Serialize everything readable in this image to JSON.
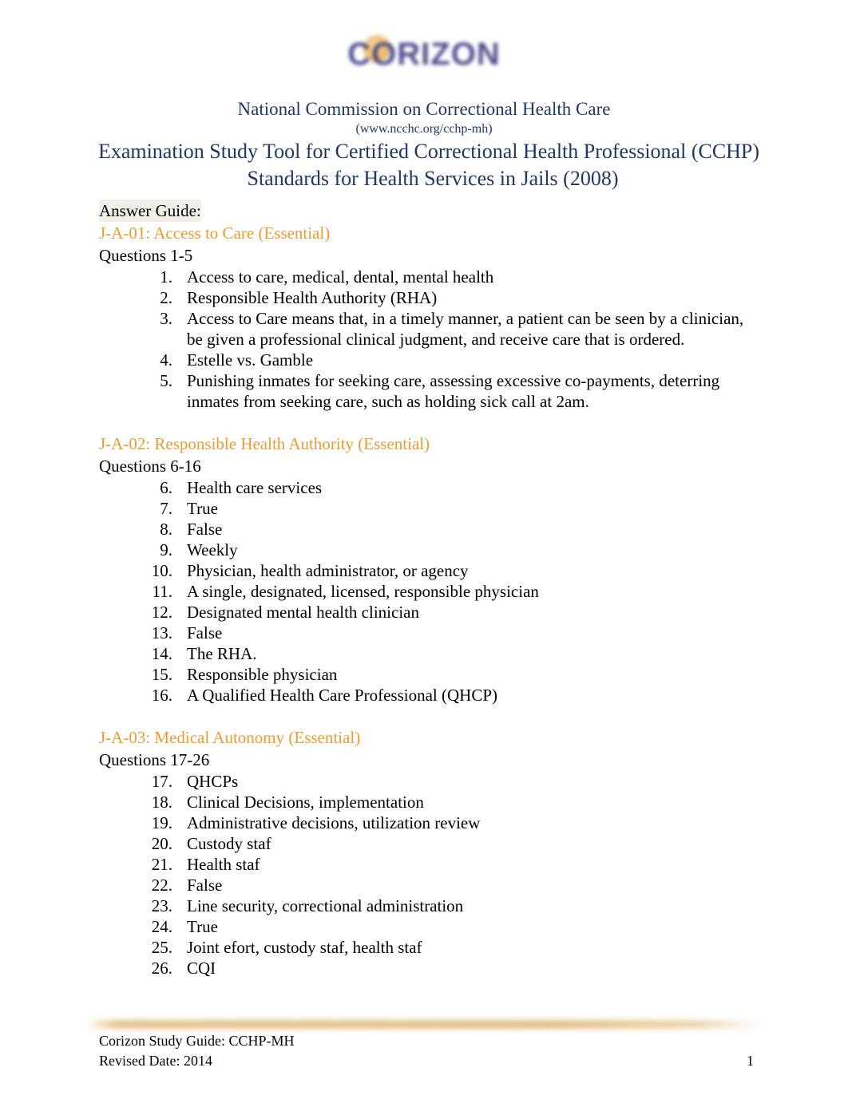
{
  "logo": {
    "brand_text": "CORIZON",
    "navy": "#3f3f83",
    "gold": "#e3a84f"
  },
  "header": {
    "organization": "National Commission on Correctional Health Care",
    "url": "(www.ncchc.org/cchp-mh)",
    "title_line1": "Examination Study Tool for Certified Correctional Health Professional (CCHP)",
    "title_line2": "Standards for Health Services in Jails (2008)",
    "color": "#1f3864"
  },
  "body": {
    "answer_guide_label": "Answer Guide:",
    "accent_color": "#ef9a2e",
    "sections": [
      {
        "heading": "J-A-01: Access to Care (Essential)",
        "question_range": "Questions 1-5",
        "items": [
          {
            "num": "1.",
            "text": "Access to care, medical, dental, mental health"
          },
          {
            "num": "2.",
            "text": "Responsible Health Authority (RHA)"
          },
          {
            "num": "3.",
            "text": "Access to Care means that, in a timely manner, a patient can be seen by a clinician, be given a professional clinical judgment, and receive care that is ordered."
          },
          {
            "num": "4.",
            "text": "Estelle vs. Gamble"
          },
          {
            "num": "5.",
            "text": "Punishing inmates for seeking care, assessing excessive co-payments, deterring inmates from seeking care, such as holding sick call at 2am."
          }
        ]
      },
      {
        "heading": "J-A-02: Responsible Health Authority (Essential)",
        "question_range": "Questions 6-16",
        "items": [
          {
            "num": "6.",
            "text": "Health care services"
          },
          {
            "num": "7.",
            "text": "True"
          },
          {
            "num": "8.",
            "text": "False"
          },
          {
            "num": "9.",
            "text": "Weekly"
          },
          {
            "num": "10.",
            "text": "Physician, health administrator, or agency"
          },
          {
            "num": "11.",
            "text": "A single, designated, licensed, responsible physician"
          },
          {
            "num": "12.",
            "text": "Designated mental health clinician"
          },
          {
            "num": "13.",
            "text": "False"
          },
          {
            "num": "14.",
            "text": "The RHA."
          },
          {
            "num": "15.",
            "text": "Responsible physician"
          },
          {
            "num": "16.",
            "text": "A Qualified Health Care Professional (QHCP)"
          }
        ]
      },
      {
        "heading": "J-A-03: Medical Autonomy (Essential)",
        "question_range": "Questions 17-26",
        "items": [
          {
            "num": "17.",
            "text": "QHCPs"
          },
          {
            "num": "18.",
            "text": "Clinical Decisions, implementation"
          },
          {
            "num": "19.",
            "text": "Administrative decisions, utilization review"
          },
          {
            "num": "20.",
            "text": "Custody staf"
          },
          {
            "num": "21.",
            "text": "Health staf"
          },
          {
            "num": "22.",
            "text": "False"
          },
          {
            "num": "23.",
            "text": "Line security, correctional administration"
          },
          {
            "num": "24.",
            "text": "True"
          },
          {
            "num": "25.",
            "text": "Joint efort, custody staf, health staf"
          },
          {
            "num": "26.",
            "text": "CQI"
          }
        ]
      }
    ]
  },
  "footer": {
    "line1": "Corizon Study Guide: CCHP-MH",
    "line2": "Revised Date: 2014",
    "page_number": "1"
  }
}
